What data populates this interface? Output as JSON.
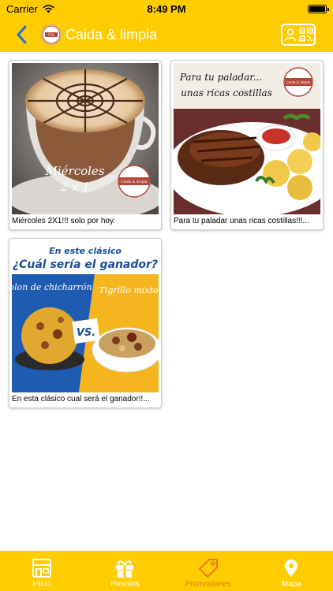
{
  "status_bar": {
    "carrier": "Carrier",
    "time": "8:49 PM"
  },
  "nav": {
    "title": "Caida & limpia",
    "logo_text": "Caida & limpia"
  },
  "promotions": [
    {
      "caption": "Miércoles 2X1!!! solo por hoy.",
      "image_text_line1": "Miércoles",
      "image_text_line2": "2 x 1",
      "image_badge": "Caida & limpia"
    },
    {
      "caption": "Para tu paladar unas ricas costillas!!!...",
      "image_text_line1": "Para tu paladar...",
      "image_text_line2": "unas ricas costillas",
      "image_badge": "Caida & limpia"
    },
    {
      "caption": "En esta clásico cual será el ganador!!...",
      "image_text_line1": "En este clásico",
      "image_text_line2": "¿Cuál sería el ganador?",
      "image_left_label": "Bolon de chicharrón",
      "image_right_label": "Tigrillo mixto",
      "image_vs": "VS."
    }
  ],
  "tabs": [
    {
      "label": "Inicio",
      "icon": "store-icon",
      "active": false
    },
    {
      "label": "Premios",
      "icon": "gift-icon",
      "active": false
    },
    {
      "label": "Promociones",
      "icon": "tag-icon",
      "active": true
    },
    {
      "label": "Mapa",
      "icon": "map-pin-icon",
      "active": false
    }
  ],
  "colors": {
    "brand_yellow": "#FFCC00",
    "back_arrow": "#1E6FD9",
    "active_tab": "#E57A1F",
    "inactive_tab": "#FFFFFF"
  }
}
